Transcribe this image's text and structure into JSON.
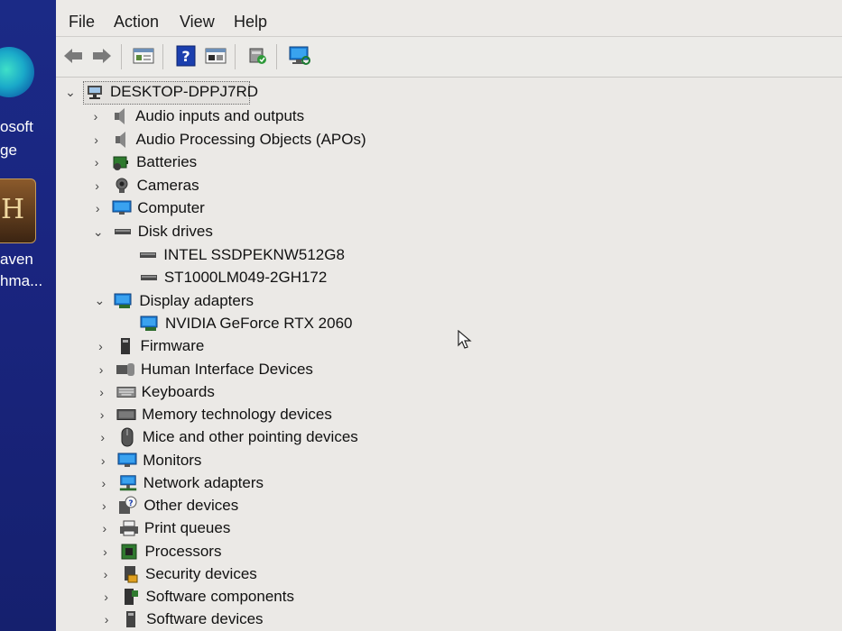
{
  "desktop": {
    "labels": [
      "osoft",
      "ge",
      "aven",
      "hma..."
    ]
  },
  "menu": {
    "file": "File",
    "action": "Action",
    "view": "View",
    "help": "Help"
  },
  "toolbar": {
    "icons": [
      "back-arrow-icon",
      "forward-arrow-icon",
      "properties-icon",
      "help-icon",
      "view-icon",
      "update-driver-icon",
      "scan-hardware-icon"
    ]
  },
  "tree": {
    "root": "DESKTOP-DPPJ7RD",
    "nodes": [
      {
        "label": "Audio inputs and outputs",
        "icon": "speaker-icon",
        "expanded": false
      },
      {
        "label": "Audio Processing Objects (APOs)",
        "icon": "speaker-icon",
        "expanded": false
      },
      {
        "label": "Batteries",
        "icon": "battery-icon",
        "expanded": false
      },
      {
        "label": "Cameras",
        "icon": "camera-icon",
        "expanded": false
      },
      {
        "label": "Computer",
        "icon": "monitor-icon",
        "expanded": false
      },
      {
        "label": "Disk drives",
        "icon": "disk-drive-icon",
        "expanded": true
      },
      {
        "label": "INTEL SSDPEKNW512G8",
        "icon": "disk-drive-icon",
        "child": true
      },
      {
        "label": "ST1000LM049-2GH172",
        "icon": "disk-drive-icon",
        "child": true
      },
      {
        "label": "Display adapters",
        "icon": "display-adapter-icon",
        "expanded": true
      },
      {
        "label": "NVIDIA GeForce RTX 2060",
        "icon": "display-adapter-icon",
        "child": true
      },
      {
        "label": "Firmware",
        "icon": "firmware-icon",
        "expanded": false
      },
      {
        "label": "Human Interface Devices",
        "icon": "hid-icon",
        "expanded": false
      },
      {
        "label": "Keyboards",
        "icon": "keyboard-icon",
        "expanded": false
      },
      {
        "label": "Memory technology devices",
        "icon": "memory-icon",
        "expanded": false
      },
      {
        "label": "Mice and other pointing devices",
        "icon": "mouse-icon",
        "expanded": false
      },
      {
        "label": "Monitors",
        "icon": "monitor-icon",
        "expanded": false
      },
      {
        "label": "Network adapters",
        "icon": "network-icon",
        "expanded": false
      },
      {
        "label": "Other devices",
        "icon": "unknown-device-icon",
        "expanded": false
      },
      {
        "label": "Print queues",
        "icon": "printer-icon",
        "expanded": false
      },
      {
        "label": "Processors",
        "icon": "processor-icon",
        "expanded": false
      },
      {
        "label": "Security devices",
        "icon": "security-icon",
        "expanded": false
      },
      {
        "label": "Software components",
        "icon": "software-component-icon",
        "expanded": false
      },
      {
        "label": "Software devices",
        "icon": "software-device-icon",
        "expanded": false
      }
    ]
  },
  "colors": {
    "desktop_blue": "#1b2a86",
    "window_bg": "#ebe9e6",
    "monitor_blue": "#1e7fd6",
    "help_blue": "#1b3fae"
  }
}
